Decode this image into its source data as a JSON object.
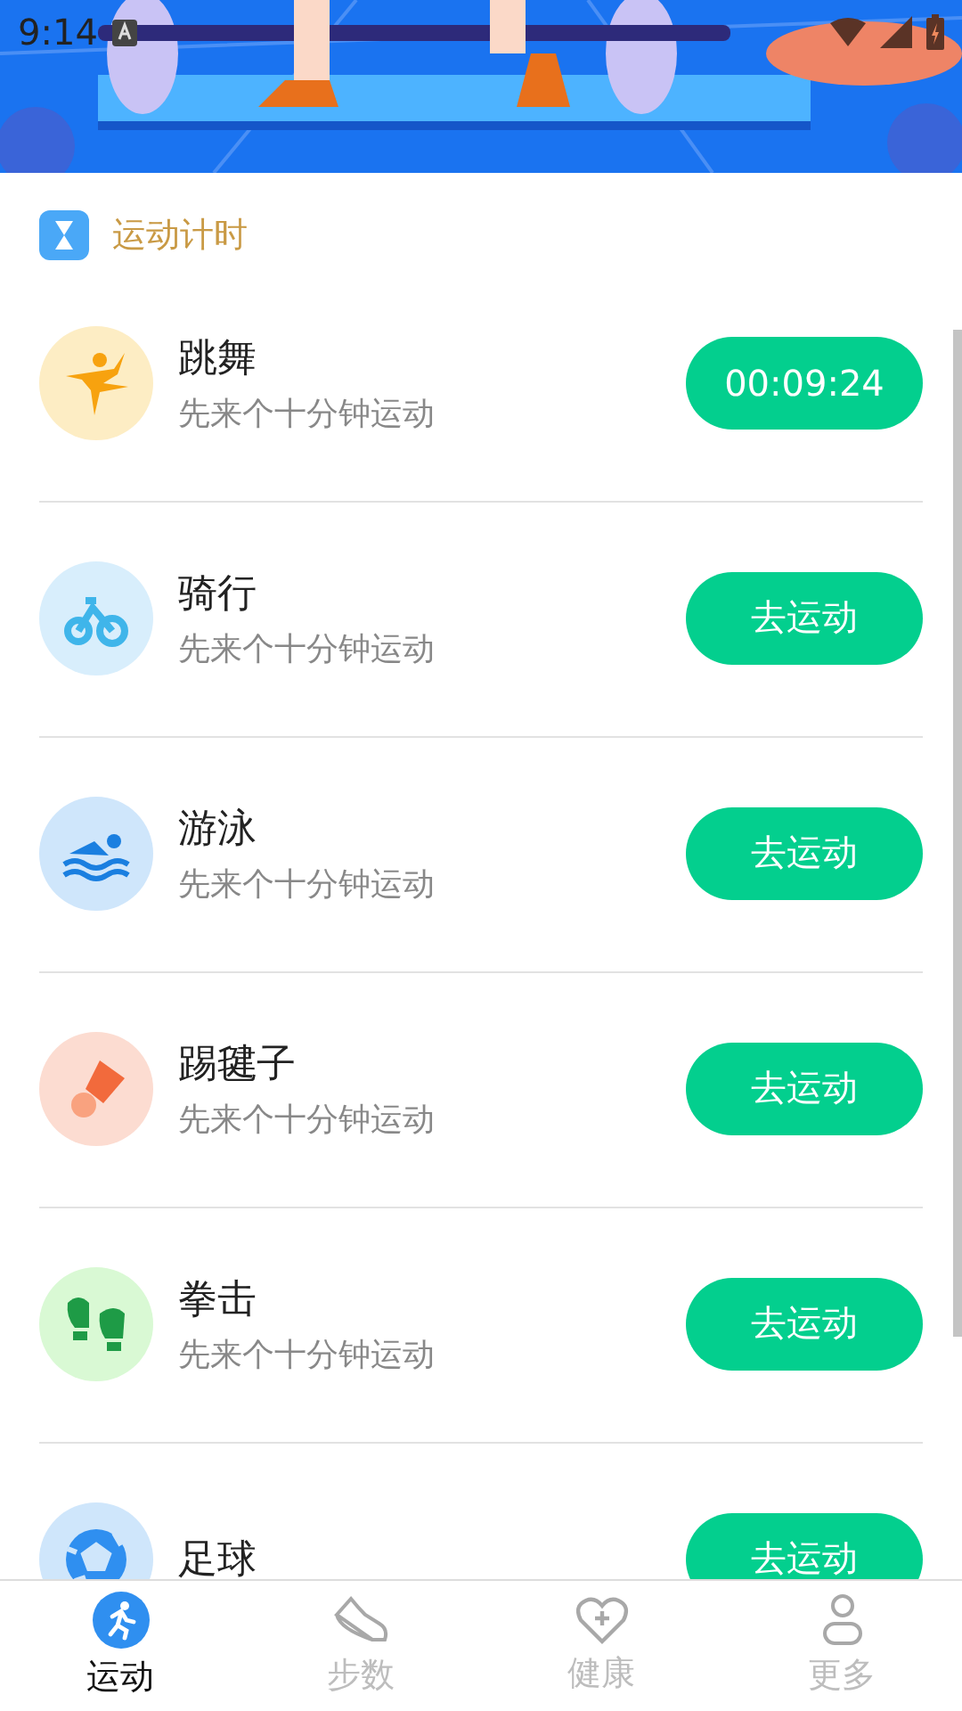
{
  "status_bar": {
    "time": "9:14"
  },
  "section": {
    "title": "运动计时"
  },
  "activities": [
    {
      "kind": "dance",
      "name": "跳舞",
      "hint": "先来个十分钟运动",
      "action": "00:09:24"
    },
    {
      "kind": "bike",
      "name": "骑行",
      "hint": "先来个十分钟运动",
      "action": "去运动"
    },
    {
      "kind": "swim",
      "name": "游泳",
      "hint": "先来个十分钟运动",
      "action": "去运动"
    },
    {
      "kind": "shuttlecock",
      "name": "踢毽子",
      "hint": "先来个十分钟运动",
      "action": "去运动"
    },
    {
      "kind": "boxing",
      "name": "拳击",
      "hint": "先来个十分钟运动",
      "action": "去运动"
    },
    {
      "kind": "football",
      "name": "足球",
      "action": "去运动"
    }
  ],
  "nav": [
    {
      "kind": "run",
      "label": "运动",
      "selected": true
    },
    {
      "kind": "shoe",
      "label": "步数",
      "selected": false
    },
    {
      "kind": "health",
      "label": "健康",
      "selected": false
    },
    {
      "kind": "user",
      "label": "更多",
      "selected": false
    }
  ]
}
